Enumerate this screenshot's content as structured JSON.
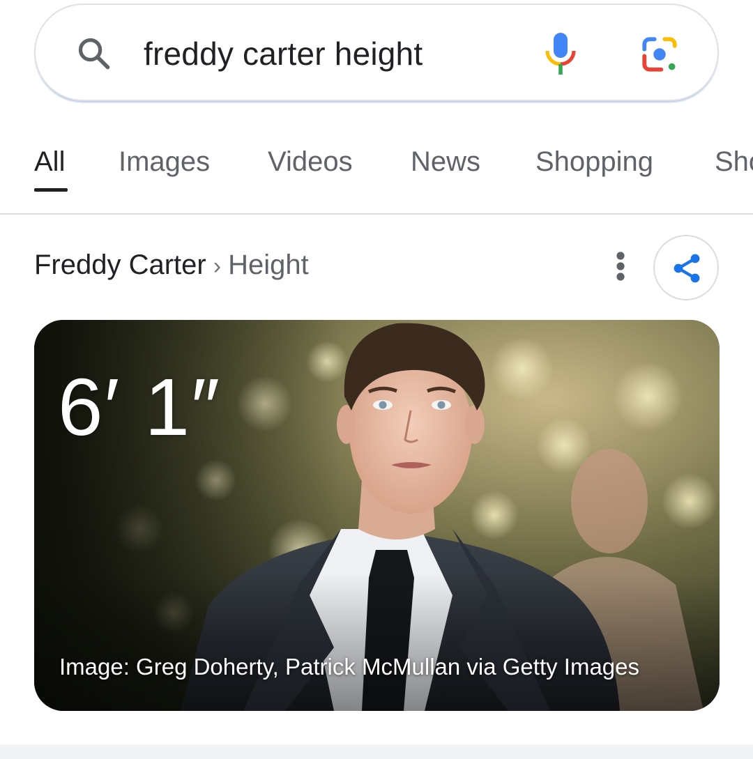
{
  "search": {
    "query": "freddy carter height"
  },
  "tabs": [
    {
      "label": "All",
      "active": true
    },
    {
      "label": "Images",
      "active": false
    },
    {
      "label": "Videos",
      "active": false
    },
    {
      "label": "News",
      "active": false
    },
    {
      "label": "Shopping",
      "active": false
    },
    {
      "label": "Sho",
      "active": false
    }
  ],
  "result": {
    "entity": "Freddy Carter",
    "separator": "›",
    "attribute": "Height",
    "height_value": "6′ 1″",
    "image_credit": "Image: Greg Doherty, Patrick McMullan via Getty Images"
  },
  "icons": {
    "search": "search-icon",
    "mic": "microphone-icon",
    "lens": "google-lens-icon",
    "more": "more-vertical-icon",
    "share": "share-icon"
  },
  "colors": {
    "google_blue": "#4285f4",
    "google_red": "#ea4335",
    "google_yellow": "#fbbc04",
    "google_green": "#34a853",
    "share_blue": "#1a73e8",
    "text_primary": "#202124",
    "text_secondary": "#5f6368"
  }
}
